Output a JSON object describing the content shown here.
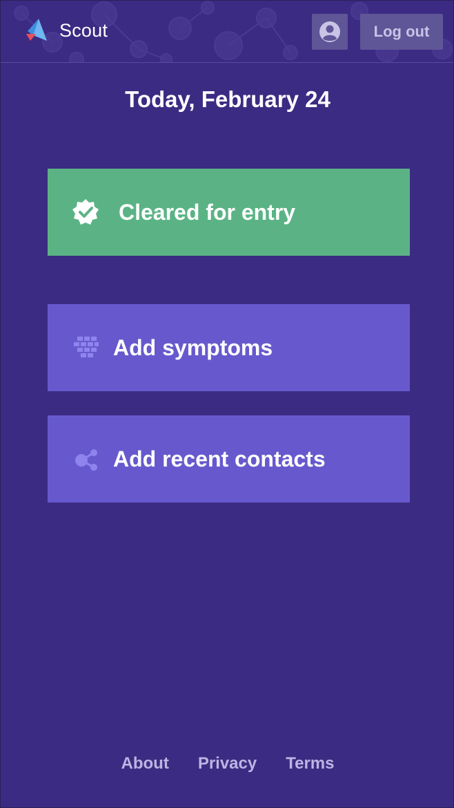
{
  "header": {
    "app_name": "Scout",
    "logout_label": "Log out",
    "profile_icon": "user-circle-icon"
  },
  "main": {
    "date_title": "Today, February 24",
    "status_card": {
      "label": "Cleared for entry",
      "icon": "verified-badge-icon",
      "color": "#5bb385"
    },
    "actions": [
      {
        "label": "Add symptoms",
        "icon": "grid-blocks-icon"
      },
      {
        "label": "Add recent contacts",
        "icon": "share-nodes-icon"
      }
    ],
    "action_color": "#6759cd"
  },
  "footer": {
    "links": [
      "About",
      "Privacy",
      "Terms"
    ]
  },
  "colors": {
    "background": "#3c2b82",
    "button": "#5f5698",
    "footer_link": "#bdb4e3"
  }
}
